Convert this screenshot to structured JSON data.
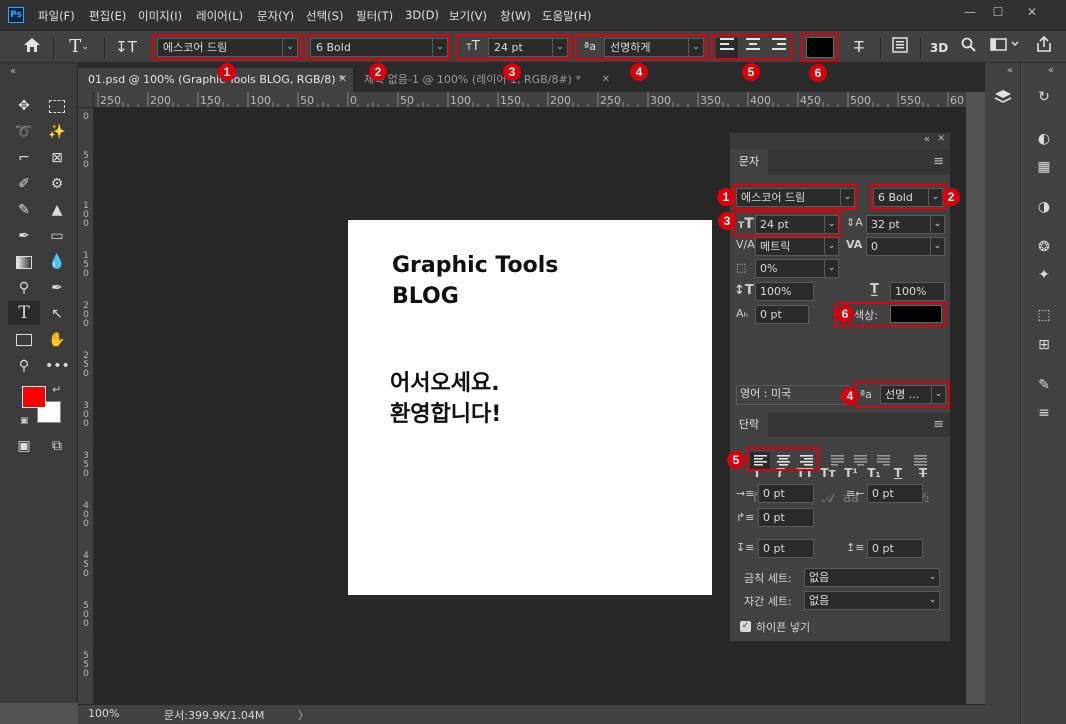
{
  "app": {
    "logo": "Ps"
  },
  "menu": [
    "파일(F)",
    "편집(E)",
    "이미지(I)",
    "레이어(L)",
    "문자(Y)",
    "선택(S)",
    "필터(T)",
    "3D(D)",
    "보기(V)",
    "창(W)",
    "도움말(H)"
  ],
  "window_controls": [
    "—",
    "☐",
    "✕"
  ],
  "options_bar": {
    "font_family": "에스코어 드림",
    "font_style": "6 Bold",
    "font_size": "24 pt",
    "antialias": "선명하게",
    "text_color": "#000000"
  },
  "markers": [
    "1",
    "2",
    "3",
    "4",
    "5",
    "6"
  ],
  "tabs": [
    {
      "title": "01.psd @ 100% (Graphic Tools BLOG, RGB/8) *",
      "close": "✕",
      "active": true
    },
    {
      "title": "제목 없음-1 @ 100% (레이어 1, RGB/8#) *",
      "close": "✕",
      "active": false
    }
  ],
  "ruler_top": [
    "250",
    "200",
    "150",
    "100",
    "50",
    "0",
    "50",
    "100",
    "150",
    "200",
    "250",
    "300",
    "350",
    "400",
    "450",
    "500",
    "550",
    "60"
  ],
  "ruler_left": [
    "0",
    "5",
    "0",
    "1",
    "0",
    "0",
    "1",
    "5",
    "0",
    "2",
    "0",
    "0",
    "2",
    "5",
    "0",
    "3",
    "0",
    "0",
    "3",
    "5",
    "0",
    "4",
    "0",
    "0",
    "4",
    "5",
    "0",
    "5",
    "0",
    "0",
    "5",
    "5",
    "0"
  ],
  "canvas": {
    "line1": "Graphic Tools",
    "line2": "BLOG",
    "line3": "어서오세요.",
    "line4": "환영합니다!"
  },
  "status": {
    "zoom": "100%",
    "doc": "문서:399.9K/1.04M",
    "arrow": "〉"
  },
  "char_panel": {
    "tab_char": "문자",
    "tab_para": "단락",
    "collapse": "«",
    "close": "✕",
    "menu": "≡",
    "font_family": "에스코어 드림",
    "font_style": "6 Bold",
    "font_size": "24 pt",
    "leading": "32 pt",
    "kerning": "메트릭",
    "tracking": "0",
    "scale_pct": "0%",
    "vscale": "100%",
    "hscale": "100%",
    "baseline": "0 pt",
    "color_label": "색상:",
    "color": "#000000",
    "language": "영어 : 미국",
    "antialias": "선명 ...",
    "fx_buttons": [
      "T",
      "T",
      "TT",
      "Tт",
      "T¹",
      "T₁",
      "T",
      "T"
    ],
    "ot_buttons": [
      "fi",
      "ℴ",
      "st",
      "𝒜",
      "aa",
      "T",
      "1st",
      "½"
    ],
    "indent_left": "0 pt",
    "indent_right": "0 pt",
    "indent_first": "0 pt",
    "space_before": "0 pt",
    "space_after": "0 pt",
    "kinsoku_label": "금칙 세트:",
    "kinsoku_value": "없음",
    "mojikumi_label": "자간 세트:",
    "mojikumi_value": "없음",
    "hyphenate": "하이픈 넣기"
  },
  "accent_red": "#e0000b"
}
